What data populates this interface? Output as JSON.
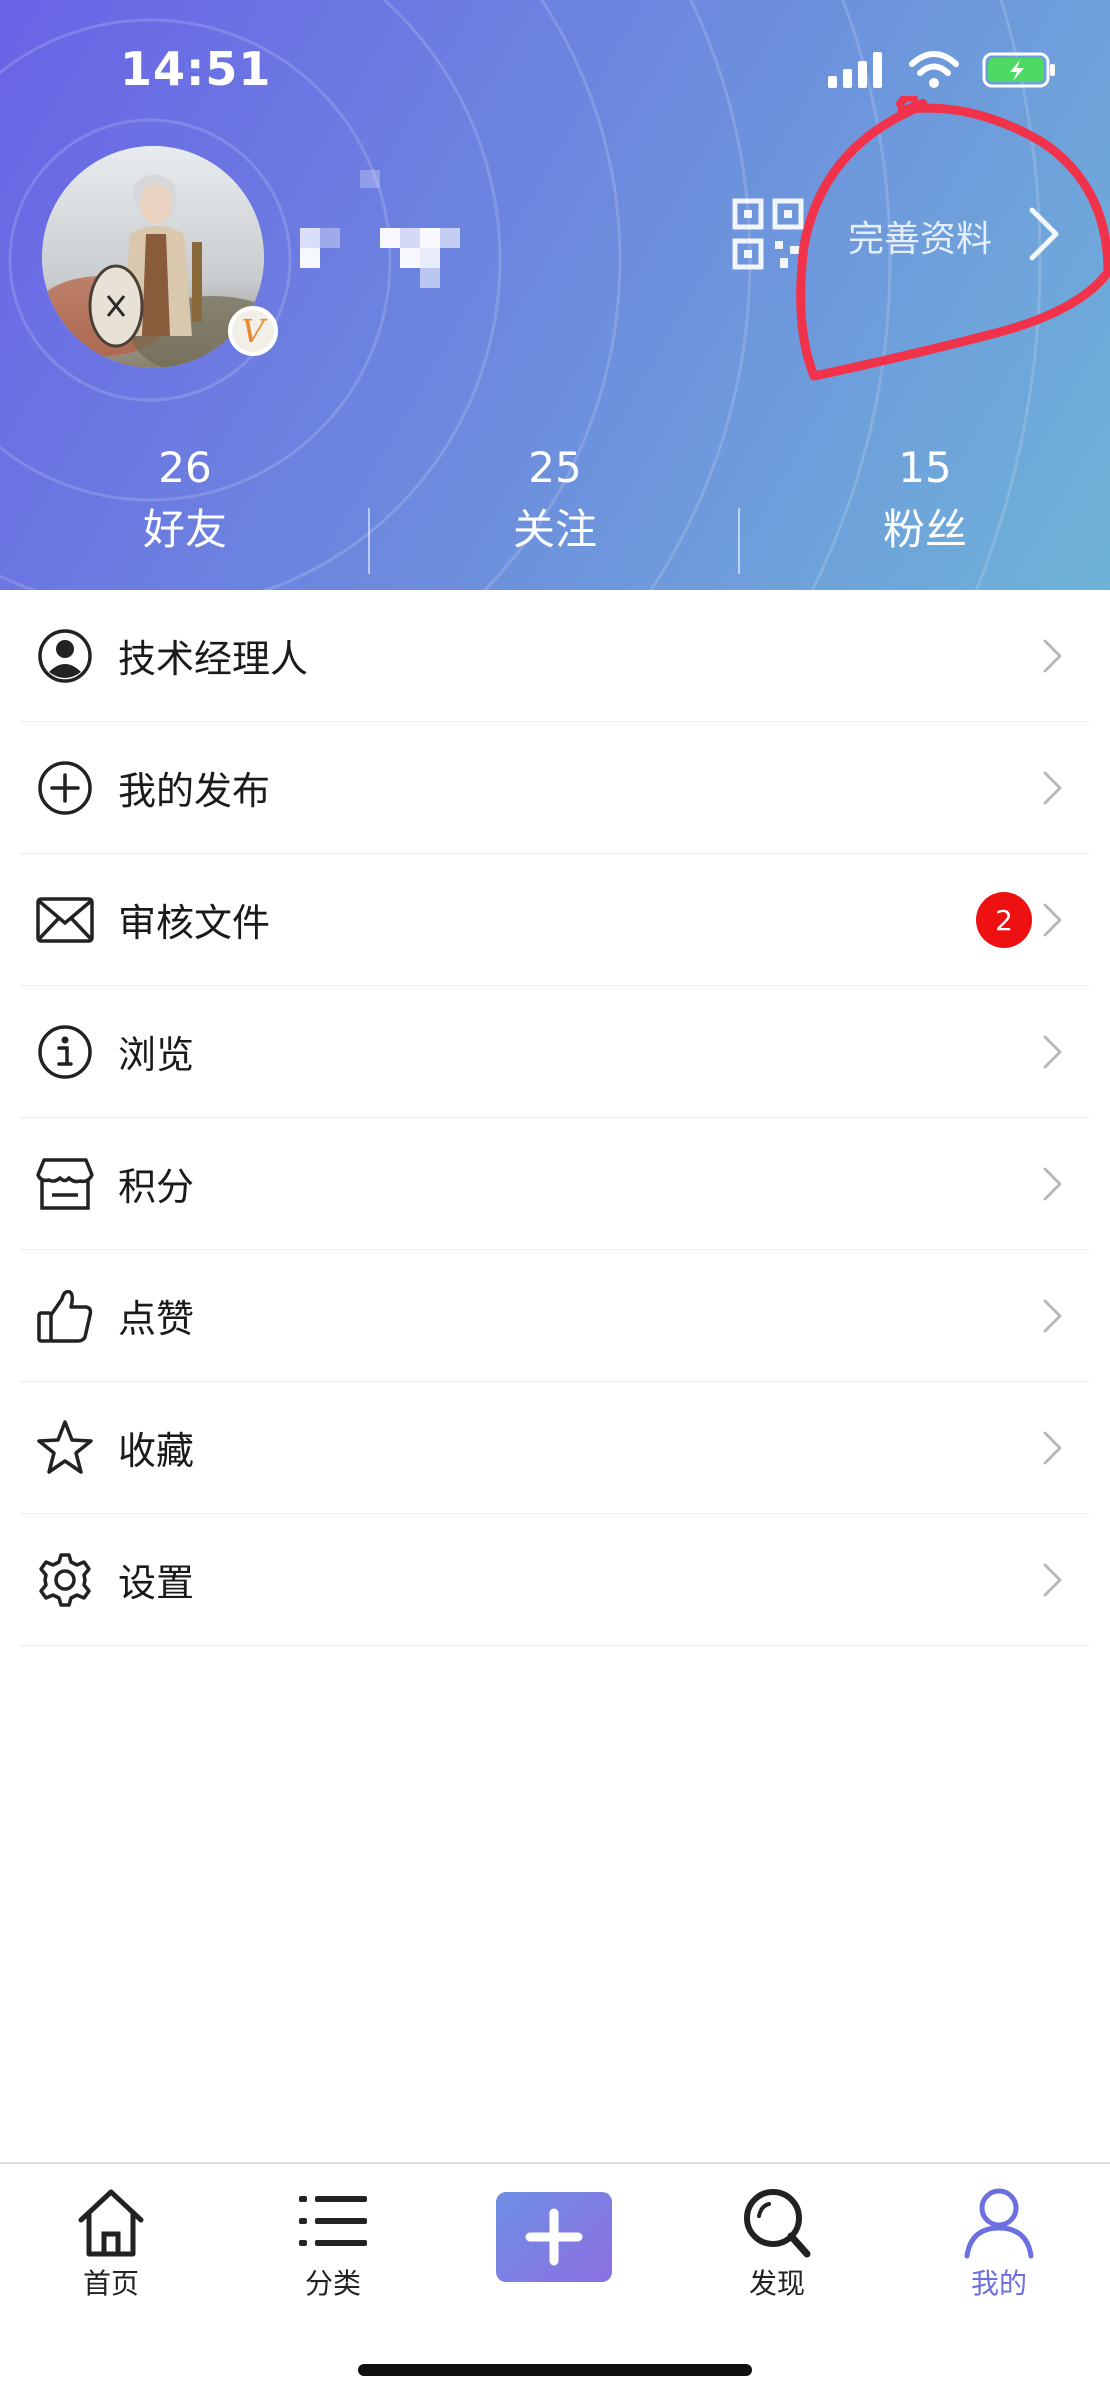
{
  "status_bar": {
    "time": "14:51"
  },
  "profile": {
    "vip_badge": "V",
    "complete_profile_label": "完善资料"
  },
  "stats": [
    {
      "count": "26",
      "label": "好友"
    },
    {
      "count": "25",
      "label": "关注"
    },
    {
      "count": "15",
      "label": "粉丝"
    }
  ],
  "menu": {
    "items": [
      {
        "label": "技术经理人",
        "icon": "person-circle-icon"
      },
      {
        "label": "我的发布",
        "icon": "plus-circle-icon"
      },
      {
        "label": "审核文件",
        "icon": "envelope-icon",
        "badge": "2"
      },
      {
        "label": "浏览",
        "icon": "info-circle-icon"
      },
      {
        "label": "积分",
        "icon": "store-icon"
      },
      {
        "label": "点赞",
        "icon": "thumbs-up-icon"
      },
      {
        "label": "收藏",
        "icon": "star-icon"
      },
      {
        "label": "设置",
        "icon": "gear-icon"
      }
    ]
  },
  "tabbar": {
    "tabs": [
      {
        "label": "首页",
        "icon": "home-icon"
      },
      {
        "label": "分类",
        "icon": "list-icon"
      },
      {
        "label": "",
        "icon": "add-icon"
      },
      {
        "label": "发现",
        "icon": "search-icon"
      },
      {
        "label": "我的",
        "icon": "user-icon",
        "active": true
      }
    ]
  },
  "colors": {
    "header_gradient_start": "#6a63e6",
    "header_gradient_end": "#6fb3d8",
    "badge_red": "#ee1111",
    "active_tab": "#6b6fe0",
    "annotation_red": "#f0334a"
  }
}
